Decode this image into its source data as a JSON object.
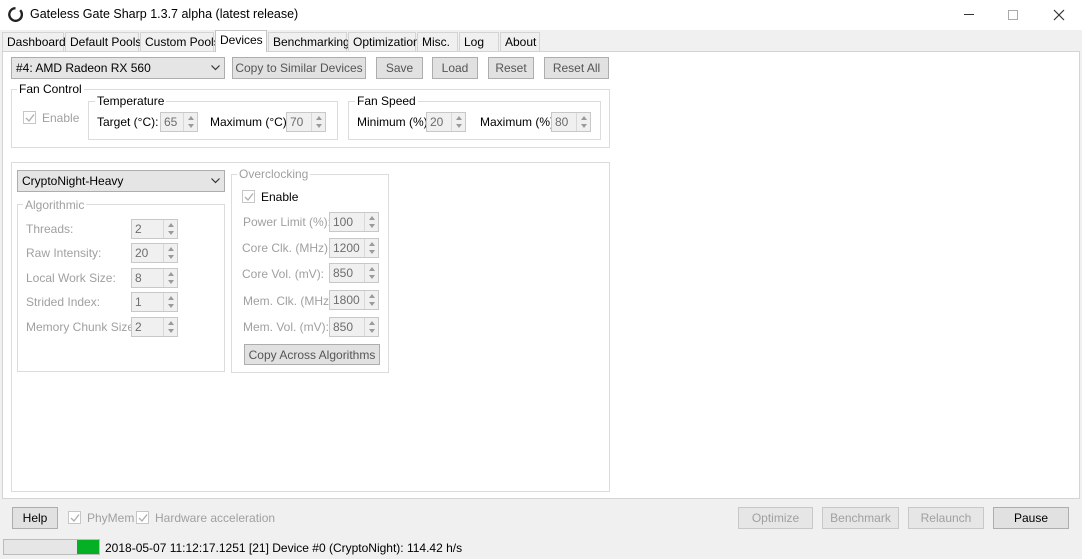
{
  "window": {
    "title": "Gateless Gate Sharp 1.3.7 alpha (latest release)",
    "minimize_glyph": "—",
    "maximize_glyph": "☐",
    "close_glyph": "✕"
  },
  "tabs": [
    {
      "label": "Dashboard"
    },
    {
      "label": "Default Pools"
    },
    {
      "label": "Custom Pools"
    },
    {
      "label": "Devices",
      "active": true
    },
    {
      "label": "Benchmarking"
    },
    {
      "label": "Optimization"
    },
    {
      "label": "Misc."
    },
    {
      "label": "Log"
    },
    {
      "label": "About"
    }
  ],
  "devices": {
    "device_select": "#4: AMD Radeon RX 560",
    "copy_similar": "Copy to Similar Devices",
    "save": "Save",
    "load": "Load",
    "reset": "Reset",
    "reset_all": "Reset All",
    "fan_control": {
      "group_label": "Fan Control",
      "enable_label": "Enable",
      "enable_checked": true,
      "temperature": {
        "group_label": "Temperature",
        "target_label": "Target (°C):",
        "target_value": "65",
        "maximum_label": "Maximum (°C):",
        "maximum_value": "70"
      },
      "fan_speed": {
        "group_label": "Fan Speed",
        "minimum_label": "Minimum (%):",
        "minimum_value": "20",
        "maximum_label": "Maximum (%):",
        "maximum_value": "80"
      }
    },
    "algorithm_select": "CryptoNight-Heavy",
    "algorithmic": {
      "group_label": "Algorithmic",
      "threads_label": "Threads:",
      "threads_value": "2",
      "raw_intensity_label": "Raw Intensity:",
      "raw_intensity_value": "20",
      "local_work_size_label": "Local Work Size:",
      "local_work_size_value": "8",
      "strided_index_label": "Strided Index:",
      "strided_index_value": "1",
      "memory_chunk_label": "Memory Chunk Size:",
      "memory_chunk_value": "2"
    },
    "overclocking": {
      "group_label": "Overclocking",
      "enable_label": "Enable",
      "enable_checked": true,
      "power_limit_label": "Power Limit (%):",
      "power_limit_value": "100",
      "core_clk_label": "Core Clk. (MHz):",
      "core_clk_value": "1200",
      "core_vol_label": "Core Vol. (mV):",
      "core_vol_value": "850",
      "mem_clk_label": "Mem. Clk. (MHz):",
      "mem_clk_value": "1800",
      "mem_vol_label": "Mem. Vol. (mV):",
      "mem_vol_value": "850",
      "copy_across": "Copy Across Algorithms"
    }
  },
  "bottom": {
    "help": "Help",
    "phymem_label": "PhyMem",
    "phymem_checked": true,
    "hw_accel_label": "Hardware acceleration",
    "hw_accel_checked": true,
    "optimize": "Optimize",
    "benchmark": "Benchmark",
    "relaunch": "Relaunch",
    "pause": "Pause"
  },
  "status": {
    "progress_fraction": 0.23,
    "progress_color": "#06b025",
    "message": "2018-05-07 11:12:17.1251 [21] Device #0 (CryptoNight): 114.42 h/s"
  },
  "icons": {
    "app": "gate-ring-icon",
    "dropdown": "chevron-down-icon",
    "check": "checkmark-icon"
  }
}
